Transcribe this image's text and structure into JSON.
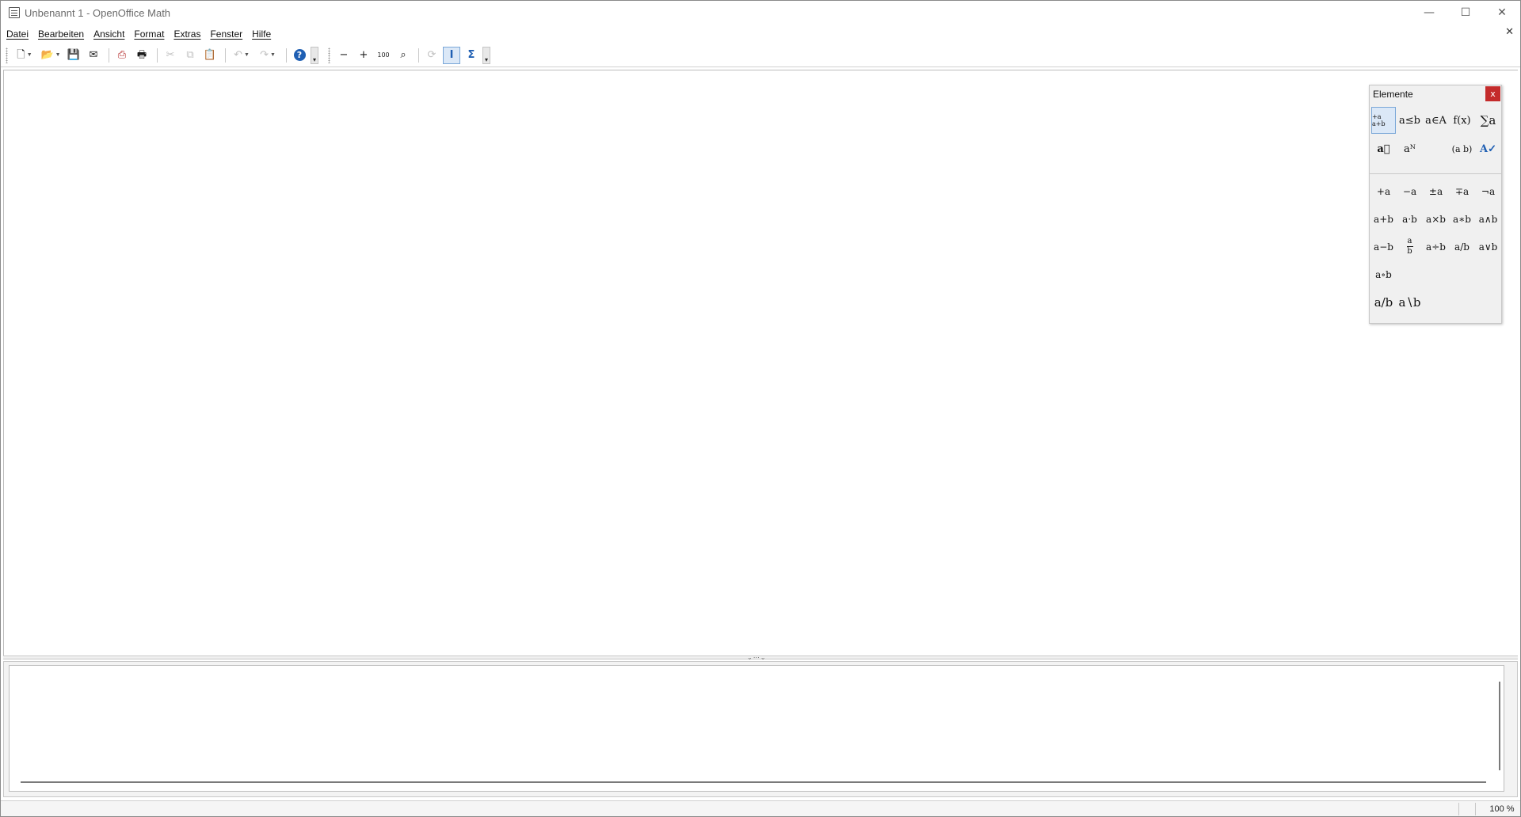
{
  "window": {
    "title": "Unbenannt 1 - OpenOffice Math",
    "controls": {
      "minimize": "—",
      "maximize": "☐",
      "close": "✕"
    }
  },
  "menubar": {
    "items": [
      "Datei",
      "Bearbeiten",
      "Ansicht",
      "Format",
      "Extras",
      "Fenster",
      "Hilfe"
    ],
    "doc_close": "✕"
  },
  "toolbar": {
    "buttons": [
      {
        "name": "new-icon",
        "glyph": "🗋",
        "dropdown": true
      },
      {
        "name": "open-icon",
        "glyph": "📂",
        "dropdown": true
      },
      {
        "name": "save-icon",
        "glyph": "💾",
        "disabled": true
      },
      {
        "name": "email-icon",
        "glyph": "✉"
      },
      {
        "name": "export-pdf-icon",
        "glyph": "⎙"
      },
      {
        "name": "print-icon",
        "glyph": "🖶"
      },
      {
        "name": "cut-icon",
        "glyph": "✂",
        "disabled": true
      },
      {
        "name": "copy-icon",
        "glyph": "⧉",
        "disabled": true
      },
      {
        "name": "paste-icon",
        "glyph": "📋",
        "disabled": true
      },
      {
        "name": "undo-icon",
        "glyph": "↶",
        "disabled": true,
        "dropdown": true
      },
      {
        "name": "redo-icon",
        "glyph": "↷",
        "disabled": true,
        "dropdown": true
      },
      {
        "name": "help-icon",
        "glyph": "?"
      },
      {
        "name": "zoom-out-icon",
        "glyph": "−"
      },
      {
        "name": "zoom-in-icon",
        "glyph": "+"
      },
      {
        "name": "zoom-100-icon",
        "glyph": "100"
      },
      {
        "name": "show-all-icon",
        "glyph": "⌕"
      },
      {
        "name": "update-icon",
        "glyph": "⟳",
        "disabled": true
      },
      {
        "name": "formula-cursor-icon",
        "glyph": "I",
        "active": true
      },
      {
        "name": "symbols-icon",
        "glyph": "Σ"
      }
    ]
  },
  "elements_panel": {
    "title": "Elemente",
    "close": "x",
    "categories": [
      "+a a+b",
      "a≤b",
      "a∈A",
      "f(x)",
      "∑a",
      "a⃗",
      "aᴺ",
      "",
      "(a b)",
      "A✓"
    ],
    "symbols": [
      "+a",
      "−a",
      "±a",
      "∓a",
      "¬a",
      "a+b",
      "a·b",
      "a×b",
      "a∗b",
      "a∧b",
      "a−b",
      "a/b",
      "a÷b",
      "a/b",
      "a∨b",
      "a∘b",
      "",
      "",
      "",
      "",
      "a/b",
      "a∖b"
    ],
    "fraction_symbol": {
      "num": "a",
      "den": "b"
    }
  },
  "statusbar": {
    "zoom": "100 %"
  }
}
